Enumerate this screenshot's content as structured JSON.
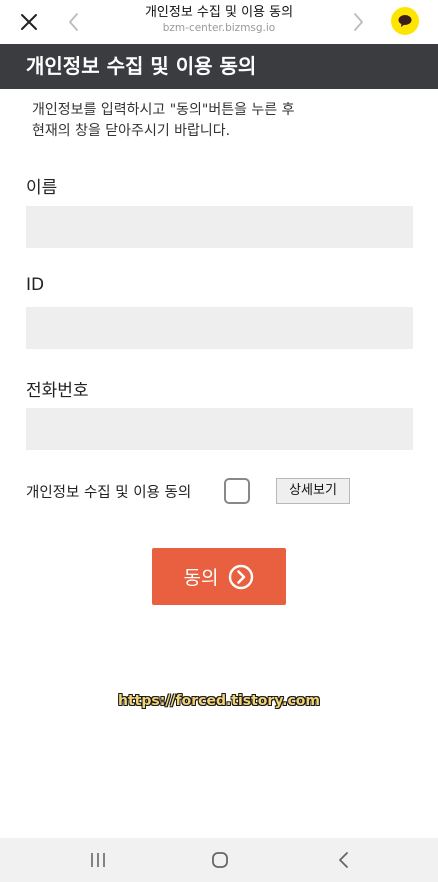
{
  "browser": {
    "title": "개인정보 수집 및 이용 동의",
    "url": "bzm-center.bizmsg.io",
    "icons": [
      "close-icon",
      "back-icon",
      "forward-icon",
      "kakaotalk-icon"
    ]
  },
  "header": {
    "title": "개인정보 수집 및 이용 동의"
  },
  "intro": {
    "text": "개인정보를 입력하시고 \"동의\"버튼을 누른 후\n현재의 창을 닫아주시기 바랍니다."
  },
  "form": {
    "name_label": "이름",
    "name_value": "",
    "id_label": "ID",
    "id_value": "",
    "phone_label": "전화번호",
    "phone_value": ""
  },
  "consent": {
    "label": "개인정보 수집 및 이용 동의",
    "checked": false,
    "detail_button": "상세보기"
  },
  "submit": {
    "label": "동의",
    "icon": "chevron-right-circle-icon",
    "color": "#e8603f"
  },
  "watermark": "https://forced.tistory.com",
  "system_nav": {
    "icons": [
      "recent-apps-icon",
      "home-icon",
      "back-icon"
    ]
  },
  "colors": {
    "header_bg": "#3b3c40",
    "accent": "#e8603f",
    "kakao": "#FEE500"
  }
}
